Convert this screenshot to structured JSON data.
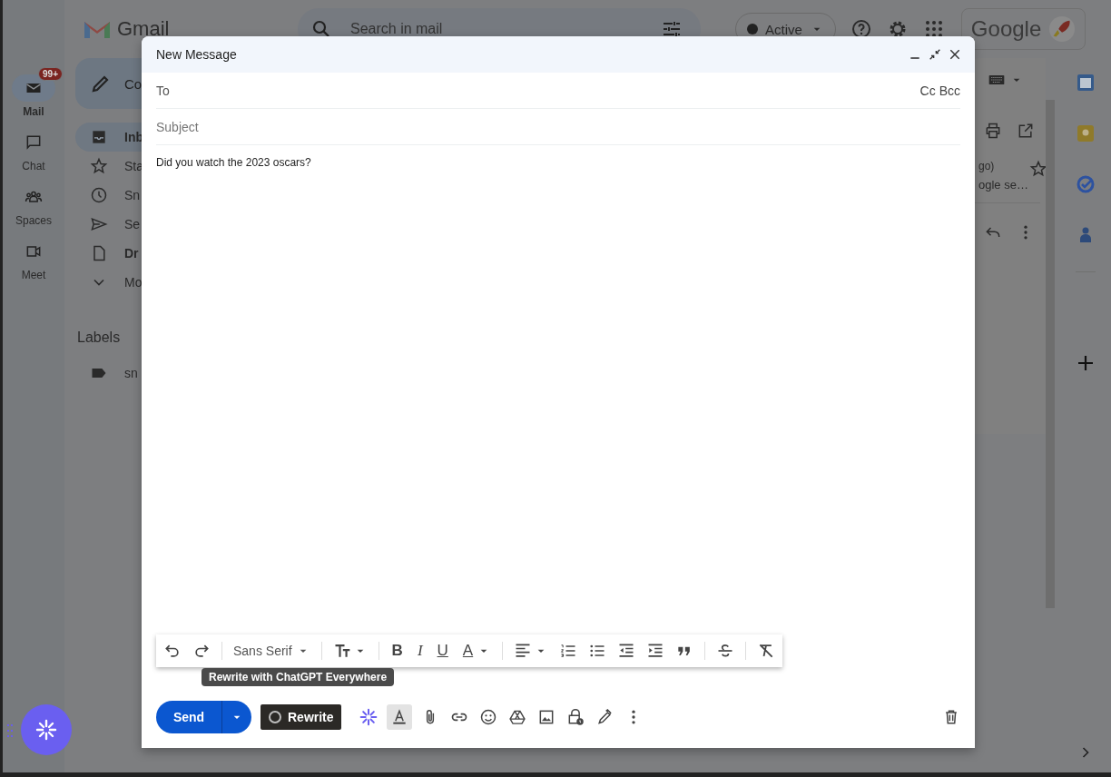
{
  "app": {
    "name": "Gmail",
    "search_placeholder": "Search in mail",
    "status": "Active",
    "brand": "Google"
  },
  "rail": [
    {
      "label": "Mail",
      "selected": true,
      "badge": "99+"
    },
    {
      "label": "Chat",
      "selected": false
    },
    {
      "label": "Spaces",
      "selected": false
    },
    {
      "label": "Meet",
      "selected": false
    }
  ],
  "nav": {
    "compose": "Co",
    "items": [
      {
        "label": "Inb",
        "selected": true,
        "bold": true
      },
      {
        "label": "Sta",
        "selected": false,
        "bold": false
      },
      {
        "label": "Sn",
        "selected": false,
        "bold": false
      },
      {
        "label": "Se",
        "selected": false,
        "bold": false
      },
      {
        "label": "Dr",
        "selected": false,
        "bold": true
      },
      {
        "label": "Mo",
        "selected": false,
        "bold": false
      }
    ],
    "labels_heading": "Labels",
    "labels": [
      "sn"
    ]
  },
  "reading": {
    "meta": "go)",
    "snippet": "ogle se…"
  },
  "compose": {
    "title": "New Message",
    "to_label": "To",
    "cc": "Cc",
    "bcc": "Bcc",
    "subject_placeholder": "Subject",
    "body": "Did you watch the 2023 oscars?",
    "format_bar": {
      "font": "Sans Serif",
      "bold": "B",
      "italic": "I",
      "underline": "U",
      "text_color": "A"
    },
    "tooltip": "Rewrite with ChatGPT Everywhere",
    "send": "Send",
    "rewrite": "Rewrite"
  }
}
